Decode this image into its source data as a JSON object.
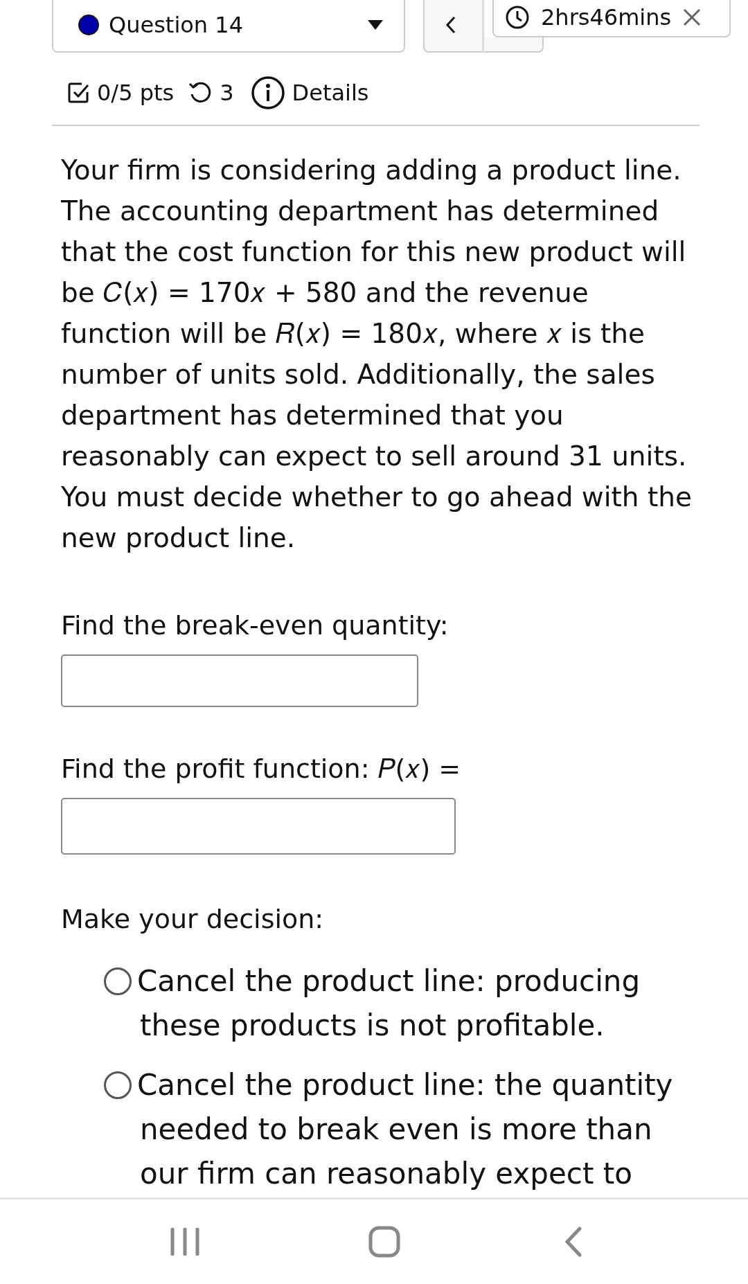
{
  "question_selector": {
    "color": "#0000aa",
    "label": "Question 14"
  },
  "timer": {
    "text": "2hrs46mins"
  },
  "meta": {
    "points": "0/5 pts",
    "attempts": "3",
    "details": "Details"
  },
  "problem": "Your firm is considering adding a product line. The accounting department has determined that the cost function for this new product will be 𝐶(𝑥) = 170𝑥 + 580 and the revenue function will be 𝑅(𝑥) = 180𝑥, where 𝑥 is the number of units sold. Additionally, the sales department has determined that you reasonably can expect to sell around 31 units. You must decide whether to go ahead with the new product line.",
  "parts": [
    {
      "kind": "number",
      "prompt": "Find the break-even quantity:"
    },
    {
      "kind": "formula",
      "prompt": "Find the profit function: 𝑃(𝑥) ="
    }
  ],
  "decision": {
    "prompt": "Make your decision:",
    "options": [
      {
        "label": "Cancel the product line: producing these products is not profitable.",
        "selected": false
      },
      {
        "label": "Cancel the product line: the quantity needed to break even is more than our firm can reasonably expect to",
        "selected": false
      }
    ]
  }
}
